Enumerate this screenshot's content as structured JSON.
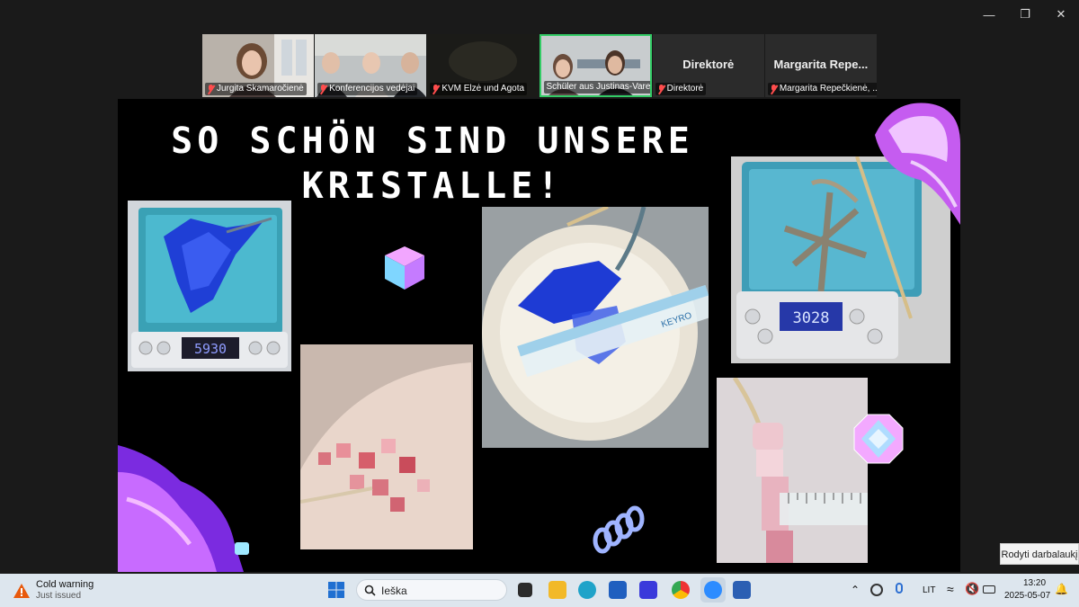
{
  "participants": [
    {
      "name": "Jurgita Skamaročienė",
      "muted": true
    },
    {
      "name": "Konferencijos vedėjai",
      "muted": true
    },
    {
      "name": "KVM Elzė und Agota",
      "muted": true
    },
    {
      "name": "Schüler aus Justinas-Vareikis",
      "muted": false
    },
    {
      "name": "Direktorė",
      "muted": true,
      "display_name": "Direktorė"
    },
    {
      "name": "Margarita Repečkienė, ...",
      "muted": true,
      "display_name": "Margarita Repe..."
    }
  ],
  "slide": {
    "title_line1": "SO SCHÖN SIND UNSERE",
    "title_line2": "KRISTALLE!",
    "scale_reading_1": "5930",
    "scale_reading_2": "3028",
    "ruler_brand": "KEYRO"
  },
  "tooltip": "Rodyti darbalaukį",
  "taskbar": {
    "weather_title": "Cold warning",
    "weather_sub": "Just issued",
    "search_placeholder": "Ieška",
    "language": "LIT",
    "time": "13:20",
    "date": "2025-05-07"
  },
  "colors": {
    "active_speaker": "#33cc66",
    "mic_off": "#ff4d4d",
    "taskbar": "#dde6ee"
  }
}
